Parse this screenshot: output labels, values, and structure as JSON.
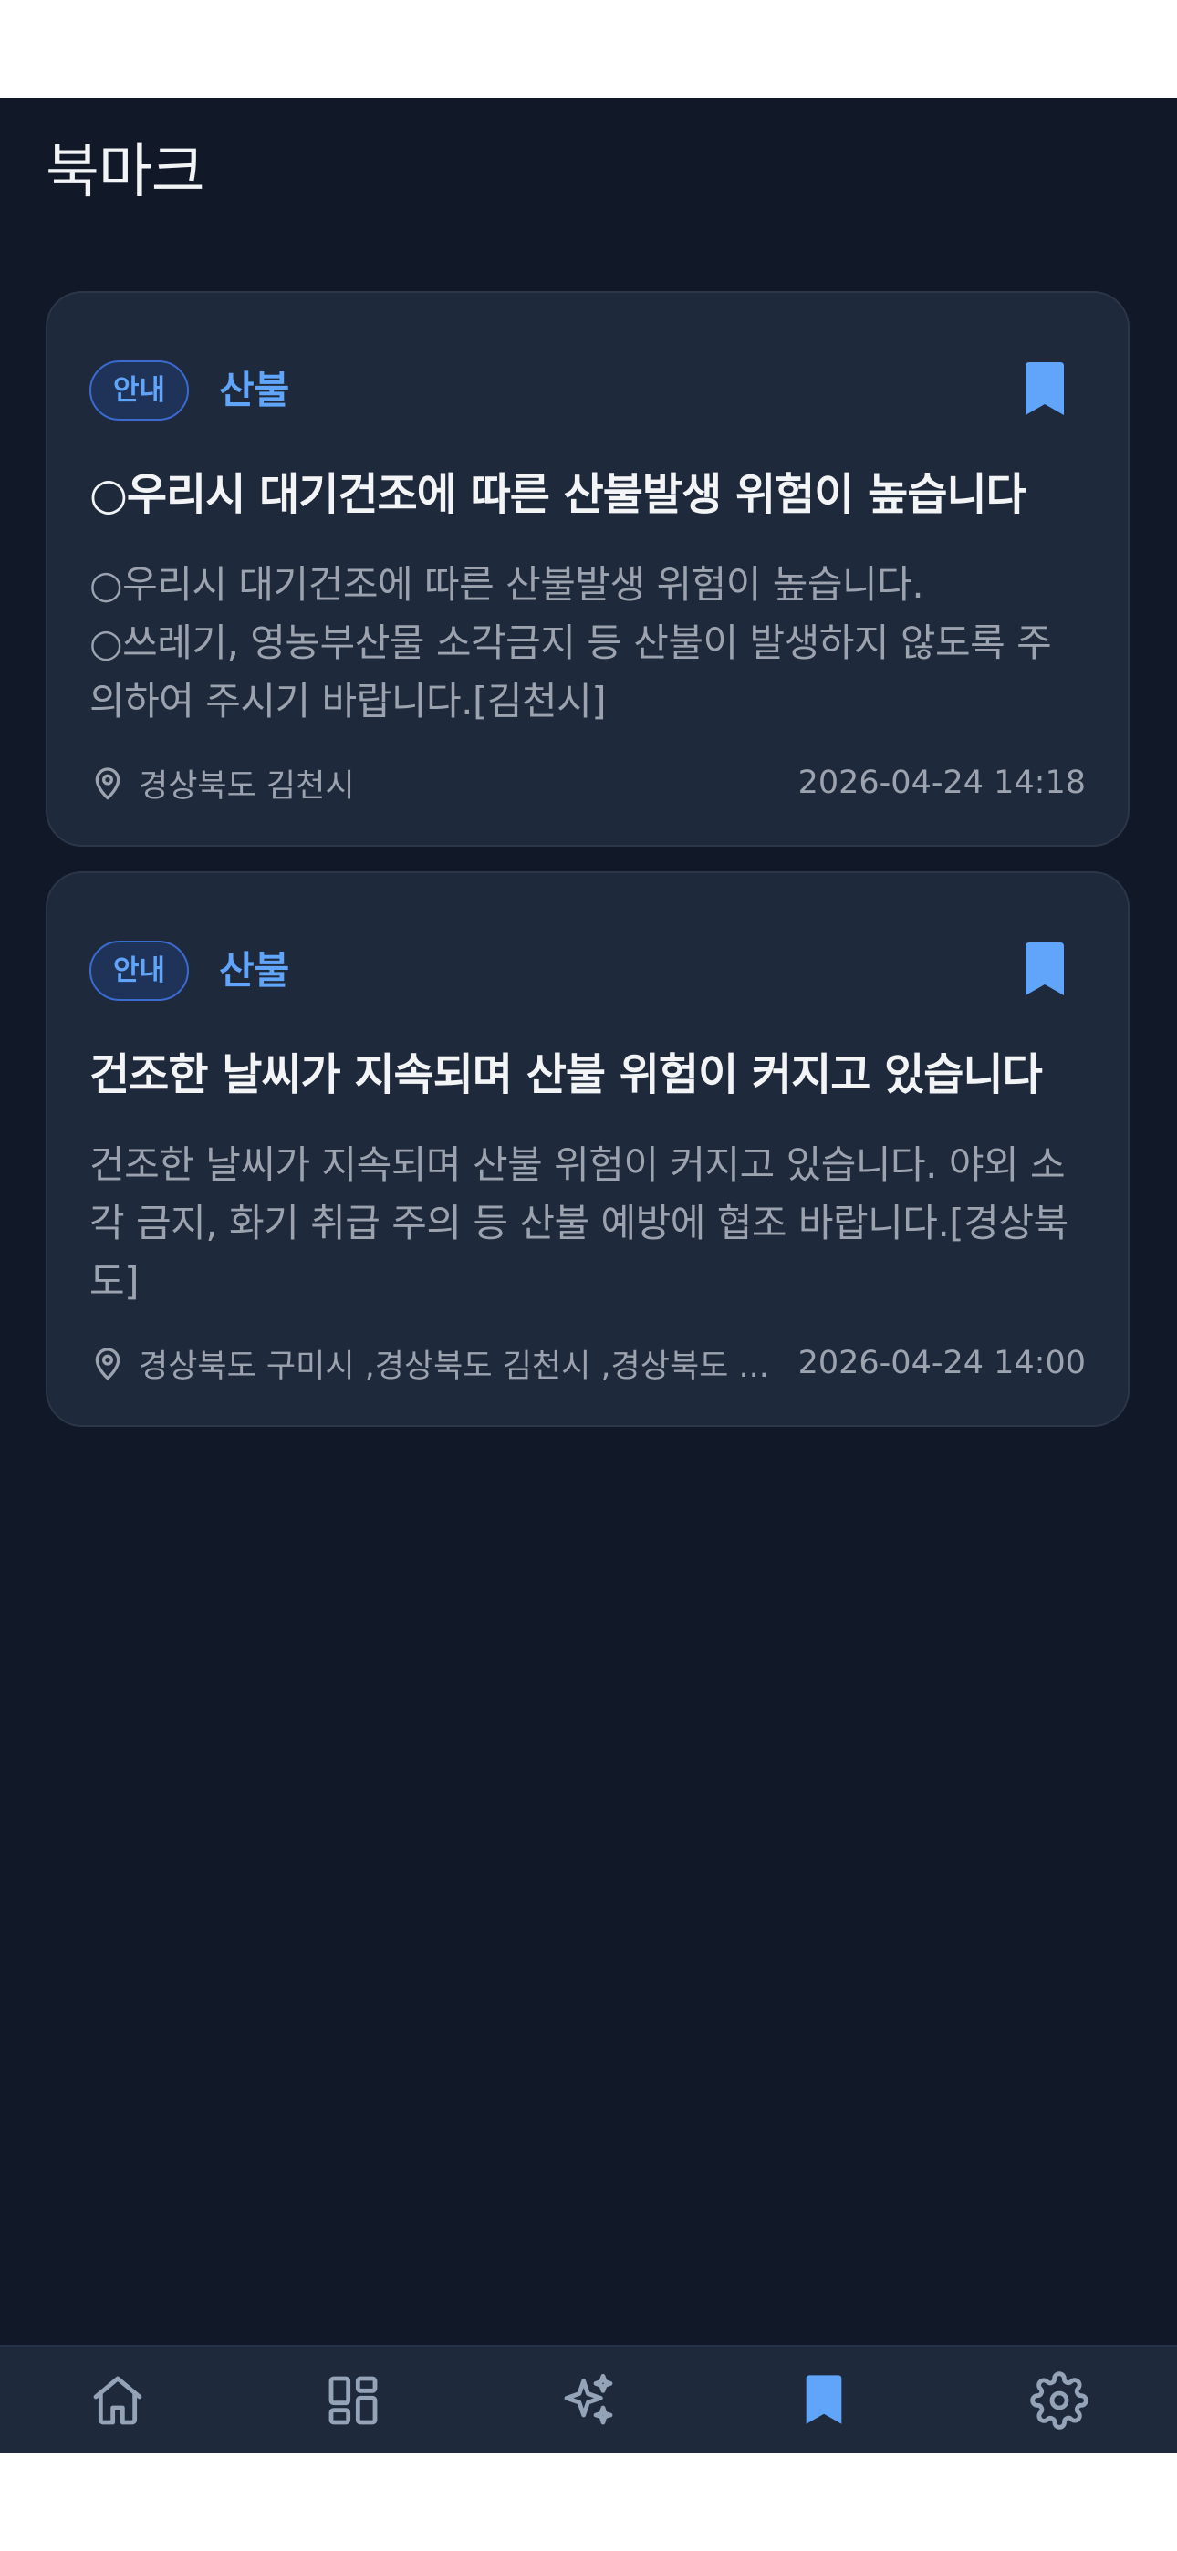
{
  "header": {
    "title": "북마크"
  },
  "bookmarks": [
    {
      "badge": "안내",
      "category": "산불",
      "title": "○우리시 대기건조에 따른 산불발생 위험이 높습니다",
      "body_lines": [
        "○우리시 대기건조에 따른 산불발생 위험이 높습니다.",
        "○쓰레기, 영농부산물 소각금지 등 산불이 발생하지 않도록 주",
        "의하여 주시기 바랍니다.[김천시]"
      ],
      "location": "경상북도 김천시",
      "timestamp": "2026-04-24 14:18",
      "bookmarked_icon": "bookmark-filled-icon"
    },
    {
      "badge": "안내",
      "category": "산불",
      "title": "건조한 날씨가 지속되며 산불 위험이 커지고 있습니다",
      "body_lines": [
        "건조한 날씨가 지속되며 산불 위험이 커지고 있습니다. 야외 소",
        "각 금지, 화기 취급 주의 등 산불 예방에 협조 바랍니다.[경상북",
        "도]"
      ],
      "location": "경상북도 구미시 ,경상북도 김천시 ,경상북도 ...",
      "timestamp": "2026-04-24 14:00",
      "bookmarked_icon": "bookmark-filled-icon"
    }
  ],
  "bottom_nav": {
    "items": [
      {
        "icon": "home-icon",
        "active": false
      },
      {
        "icon": "dashboard-icon",
        "active": false
      },
      {
        "icon": "sparkles-icon",
        "active": false
      },
      {
        "icon": "bookmark-icon",
        "active": true
      },
      {
        "icon": "gear-icon",
        "active": false
      }
    ]
  },
  "colors": {
    "background": "#111827",
    "card": "#1e293b",
    "accent": "#60a5fa",
    "text_primary": "#f3f4f6",
    "text_secondary": "#9ca3af",
    "nav_inactive": "#94a3b8"
  }
}
